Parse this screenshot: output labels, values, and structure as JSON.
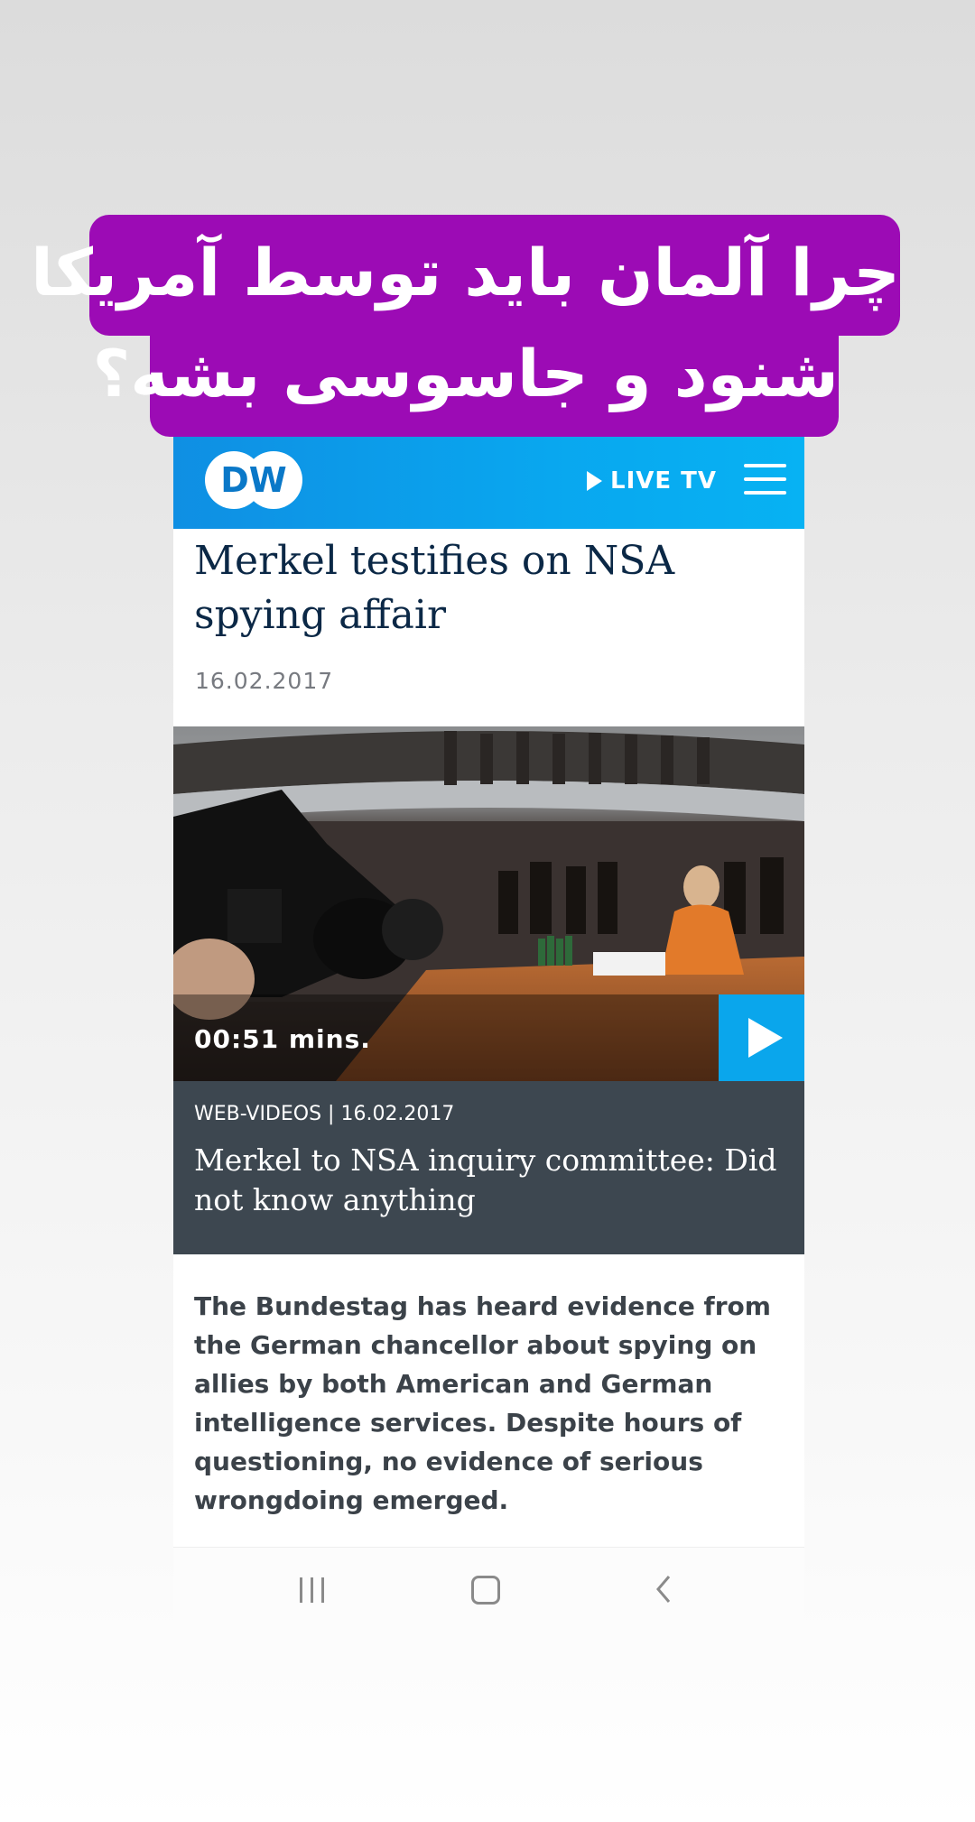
{
  "caption": {
    "line1": "چرا آلمان باید توسط آمریکا",
    "line2": "شنود و جاسوسی بشه؟",
    "background_color": "#9c0bb5"
  },
  "header": {
    "logo_text": "DW",
    "live_tv_label": "LIVE TV",
    "menu_icon": "hamburger-menu-icon",
    "bar_color": "#0aa6ec"
  },
  "article": {
    "headline": "Merkel testifies on NSA spying affair",
    "date": "16.02.2017"
  },
  "video": {
    "duration": "00:51 mins.",
    "category_date": "WEB-VIDEOS | 16.02.2017",
    "title": "Merkel to NSA inquiry committee: Did not know anything",
    "play_icon": "play-icon"
  },
  "teaser": "The Bundestag has heard evidence from the German chancellor about spying on allies by both American and German intelligence services. Despite hours of questioning, no evidence of serious wrongdoing emerged.",
  "navbar": {
    "recent_icon": "recent-apps-icon",
    "home_icon": "home-icon",
    "back_icon": "back-icon"
  }
}
